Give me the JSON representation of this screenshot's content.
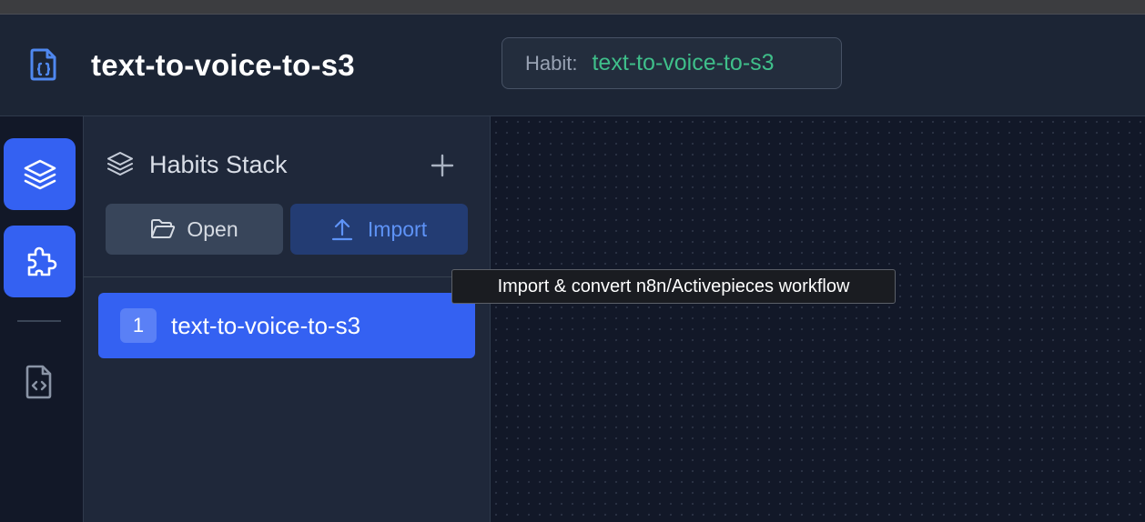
{
  "header": {
    "title": "text-to-voice-to-s3",
    "file_icon": "code-file-icon",
    "habit_badge": {
      "label": "Habit:",
      "value": "text-to-voice-to-s3"
    }
  },
  "rail": {
    "items": [
      {
        "icon": "layers-icon",
        "active": true
      },
      {
        "icon": "puzzle-icon",
        "active": true
      },
      {
        "icon": "code-file-icon",
        "active": false
      }
    ]
  },
  "panel": {
    "title": "Habits Stack",
    "title_icon": "layers-icon",
    "add_icon": "plus-icon",
    "open_label": "Open",
    "import_label": "Import",
    "habits": [
      {
        "index": "1",
        "name": "text-to-voice-to-s3"
      }
    ]
  },
  "tooltip": {
    "text": "Import & convert n8n/Activepieces workflow"
  },
  "colors": {
    "accent": "#3461f2",
    "habit_value": "#3fbf8a",
    "import_text": "#5e93f7",
    "background": "#121828",
    "panel": "#1f283a",
    "header": "#1c2535"
  }
}
